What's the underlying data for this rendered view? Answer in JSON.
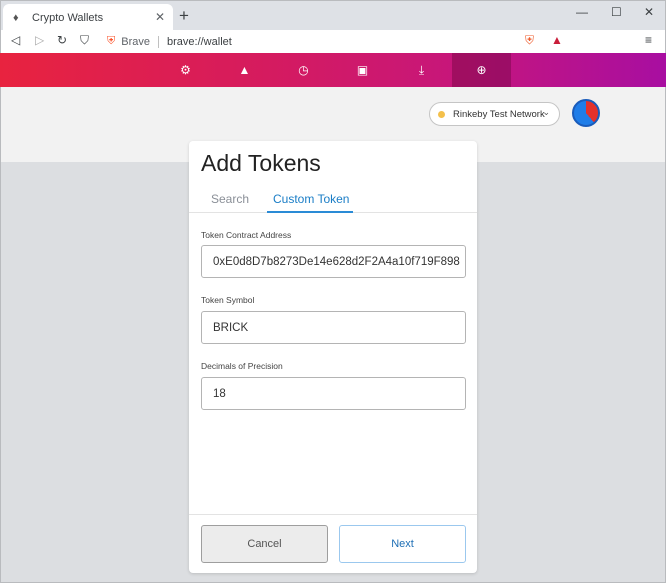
{
  "browser": {
    "tab_title": "Crypto Wallets",
    "new_tab": "+",
    "controls": {
      "minimize": "—",
      "maximize": "☐",
      "close": "✕"
    },
    "toolbar": {
      "site_label": "Brave",
      "url": "brave://wallet",
      "menu": "≡"
    }
  },
  "wallet_nav": {
    "items": [
      {
        "icon": "gear-network-icon",
        "glyph": "⚙"
      },
      {
        "icon": "triangle-icon",
        "glyph": "▲"
      },
      {
        "icon": "history-icon",
        "glyph": "◷"
      },
      {
        "icon": "save-icon",
        "glyph": "▣"
      },
      {
        "icon": "download-icon",
        "glyph": "⤓"
      },
      {
        "icon": "add-token-icon",
        "glyph": "⊕"
      }
    ]
  },
  "header": {
    "network": "Rinkeby Test Network",
    "network_color": "#f4c04b"
  },
  "dialog": {
    "title": "Add Tokens",
    "tabs": {
      "search": "Search",
      "custom": "Custom Token"
    },
    "fields": {
      "contract_label": "Token Contract Address",
      "contract_value": "0xE0d8D7b8273De14e628d2F2A4a10f719F898",
      "symbol_label": "Token Symbol",
      "symbol_value": "BRICK",
      "decimals_label": "Decimals of Precision",
      "decimals_value": "18"
    },
    "buttons": {
      "cancel": "Cancel",
      "next": "Next"
    }
  }
}
